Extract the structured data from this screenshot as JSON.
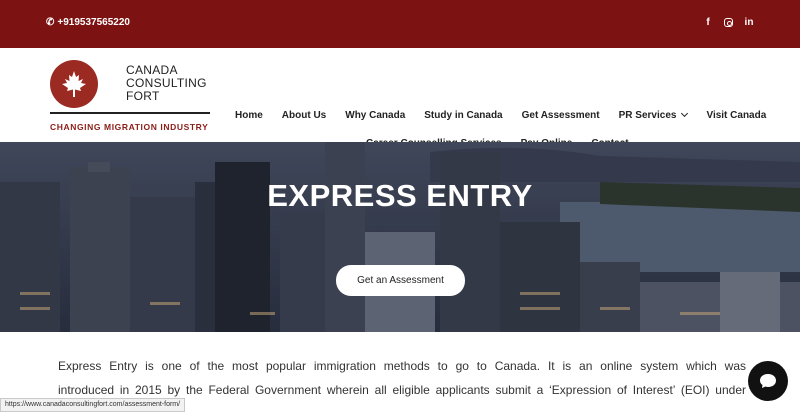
{
  "topbar": {
    "phone": "+919537565220",
    "social": [
      "facebook-icon",
      "instagram-icon",
      "linkedin-icon"
    ],
    "bg_color": "#7d1212"
  },
  "logo": {
    "line1": "CANADA",
    "line2": "CONSULTING",
    "line3": "FORT",
    "tagline": "CHANGING MIGRATION INDUSTRY"
  },
  "nav": {
    "home": "Home",
    "about": "About Us",
    "why": "Why Canada",
    "study": "Study in Canada",
    "assessment": "Get Assessment",
    "pr": "PR Services",
    "visit": "Visit Canada",
    "career": "Career Counselling Services",
    "pay": "Pay Online",
    "contact": "Contact"
  },
  "hero": {
    "title": "EXPRESS ENTRY",
    "cta": "Get an Assessment"
  },
  "content": {
    "line1": "Express Entry is one of the most popular immigration methods to go to Canada. It is an online system which was",
    "line2": "introduced in 2015 by the Federal Government wherein all eligible applicants submit a ‘Expression of Interest’ (EOI) under"
  },
  "status_url": "https://www.canadaconsultingfort.com/assessment-form/"
}
